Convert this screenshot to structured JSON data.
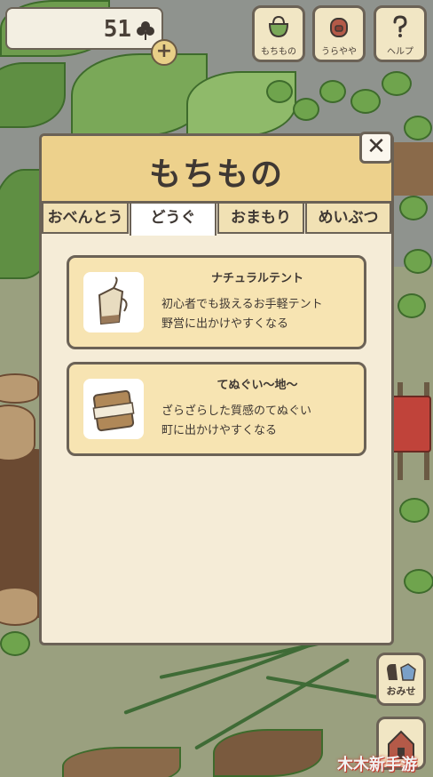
{
  "hud": {
    "clover_count": "51",
    "buttons": [
      {
        "label": "もちもの",
        "icon": "bag-icon"
      },
      {
        "label": "うらやや",
        "icon": "backpack-icon"
      },
      {
        "label": "ヘルプ",
        "icon": "question-icon"
      }
    ],
    "plus_label": "+"
  },
  "dialog": {
    "title": "もちもの",
    "close_label": "✕",
    "tabs": [
      {
        "label": "おべんとう",
        "active": false
      },
      {
        "label": "どうぐ",
        "active": true
      },
      {
        "label": "おまもり",
        "active": false
      },
      {
        "label": "めいぶつ",
        "active": false
      }
    ],
    "items": [
      {
        "name": "ナチュラルテント",
        "description": "初心者でも扱えるお手軽テント\n野営に出かけやすくなる",
        "icon": "tent-bag-icon"
      },
      {
        "name": "てぬぐい〜地〜",
        "description": "ざらざらした質感のてぬぐい\n町に出かけやすくなる",
        "icon": "towel-icon"
      }
    ]
  },
  "side": {
    "shop_label": "おみせ",
    "shop_icon": "shop-icon",
    "home_icon": "house-icon"
  },
  "watermark": "木木新手游",
  "colors": {
    "header": "#edd18c",
    "panel": "#f5ecd7",
    "card": "#f7e4b2",
    "border": "#6b6256"
  }
}
